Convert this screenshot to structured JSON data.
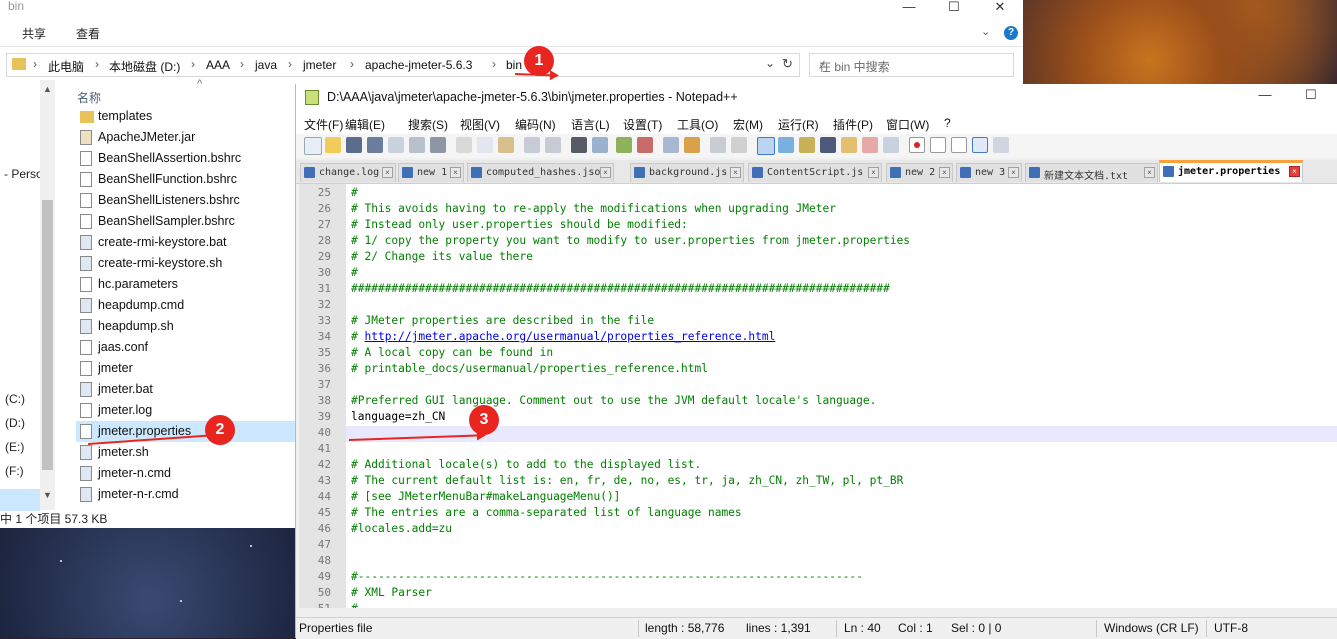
{
  "explorer": {
    "title": "bin",
    "ribbon_tabs": [
      "共享",
      "查看"
    ],
    "help_icon": "help-icon",
    "breadcrumb": [
      "此电脑",
      "本地磁盘 (D:)",
      "AAA",
      "java",
      "jmeter",
      "apache-jmeter-5.6.3",
      "bin"
    ],
    "search_placeholder": "在 bin 中搜索",
    "column_header": "名称",
    "nav_items": [
      {
        "label": "- Perso"
      },
      {
        "label": "(C:)"
      },
      {
        "label": "(D:)"
      },
      {
        "label": "(E:)"
      },
      {
        "label": "(F:)"
      }
    ],
    "files": [
      {
        "name": "templates",
        "kind": "folder"
      },
      {
        "name": "ApacheJMeter.jar",
        "kind": "jar"
      },
      {
        "name": "BeanShellAssertion.bshrc",
        "kind": "file"
      },
      {
        "name": "BeanShellFunction.bshrc",
        "kind": "file"
      },
      {
        "name": "BeanShellListeners.bshrc",
        "kind": "file"
      },
      {
        "name": "BeanShellSampler.bshrc",
        "kind": "file"
      },
      {
        "name": "create-rmi-keystore.bat",
        "kind": "bat"
      },
      {
        "name": "create-rmi-keystore.sh",
        "kind": "bat"
      },
      {
        "name": "hc.parameters",
        "kind": "file"
      },
      {
        "name": "heapdump.cmd",
        "kind": "bat"
      },
      {
        "name": "heapdump.sh",
        "kind": "bat"
      },
      {
        "name": "jaas.conf",
        "kind": "file"
      },
      {
        "name": "jmeter",
        "kind": "file"
      },
      {
        "name": "jmeter.bat",
        "kind": "bat"
      },
      {
        "name": "jmeter.log",
        "kind": "file"
      },
      {
        "name": "jmeter.properties",
        "kind": "file",
        "selected": true
      },
      {
        "name": "jmeter.sh",
        "kind": "bat"
      },
      {
        "name": "jmeter-n.cmd",
        "kind": "bat"
      },
      {
        "name": "jmeter-n-r.cmd",
        "kind": "bat"
      }
    ],
    "status": "中 1 个项目   57.3 KB"
  },
  "npp": {
    "title": "D:\\AAA\\java\\jmeter\\apache-jmeter-5.6.3\\bin\\jmeter.properties - Notepad++",
    "menu": [
      "文件(F)",
      "编辑(E)",
      "搜索(S)",
      "视图(V)",
      "编码(N)",
      "语言(L)",
      "设置(T)",
      "工具(O)",
      "宏(M)",
      "运行(R)",
      "插件(P)",
      "窗口(W)",
      "?"
    ],
    "tabs": [
      {
        "label": "change.log"
      },
      {
        "label": "new 1"
      },
      {
        "label": "computed_hashes.json"
      },
      {
        "label": "background.js"
      },
      {
        "label": "ContentScript.js"
      },
      {
        "label": "new 2"
      },
      {
        "label": "new 3"
      },
      {
        "label": "新建文本文档.txt"
      },
      {
        "label": "jmeter.properties",
        "active": true
      }
    ],
    "lines": [
      {
        "n": "25",
        "t": "#"
      },
      {
        "n": "26",
        "t": "# This avoids having to re-apply the modifications when upgrading JMeter"
      },
      {
        "n": "27",
        "t": "# Instead only user.properties should be modified:"
      },
      {
        "n": "28",
        "t": "# 1/ copy the property you want to modify to user.properties from jmeter.properties"
      },
      {
        "n": "29",
        "t": "# 2/ Change its value there"
      },
      {
        "n": "30",
        "t": "#"
      },
      {
        "n": "31",
        "t": "################################################################################"
      },
      {
        "n": "32",
        "t": ""
      },
      {
        "n": "33",
        "t": "# JMeter properties are described in the file"
      },
      {
        "n": "34",
        "t": "# ",
        "url": "http://jmeter.apache.org/usermanual/properties_reference.html"
      },
      {
        "n": "35",
        "t": "# A local copy can be found in"
      },
      {
        "n": "36",
        "t": "# printable_docs/usermanual/properties_reference.html"
      },
      {
        "n": "37",
        "t": ""
      },
      {
        "n": "38",
        "t": "#Preferred GUI language. Comment out to use the JVM default locale's language."
      },
      {
        "n": "39",
        "t": "language=zh_CN",
        "plain": true
      },
      {
        "n": "40",
        "t": ""
      },
      {
        "n": "41",
        "t": ""
      },
      {
        "n": "42",
        "t": "# Additional locale(s) to add to the displayed list."
      },
      {
        "n": "43",
        "t": "# The current default list is: en, fr, de, no, es, tr, ja, zh_CN, zh_TW, pl, pt_BR"
      },
      {
        "n": "44",
        "t": "# [see JMeterMenuBar#makeLanguageMenu()]"
      },
      {
        "n": "45",
        "t": "# The entries are a comma-separated list of language names"
      },
      {
        "n": "46",
        "t": "#locales.add=zu"
      },
      {
        "n": "47",
        "t": ""
      },
      {
        "n": "48",
        "t": ""
      },
      {
        "n": "49",
        "t": "#---------------------------------------------------------------------------"
      },
      {
        "n": "50",
        "t": "# XML Parser"
      },
      {
        "n": "51",
        "t": "#---------------------------------------------------------------------------"
      }
    ],
    "status": {
      "type": "Properties file",
      "length": "length : 58,776",
      "lines": "lines : 1,391",
      "ln": "Ln : 40",
      "col": "Col : 1",
      "sel": "Sel : 0 | 0",
      "eol": "Windows (CR LF)",
      "encoding": "UTF-8"
    }
  },
  "markers": [
    "1",
    "2",
    "3"
  ],
  "colors": {
    "marker": "#e8251f",
    "comment": "#008000",
    "tab_active_accent": "#f7a33a"
  }
}
